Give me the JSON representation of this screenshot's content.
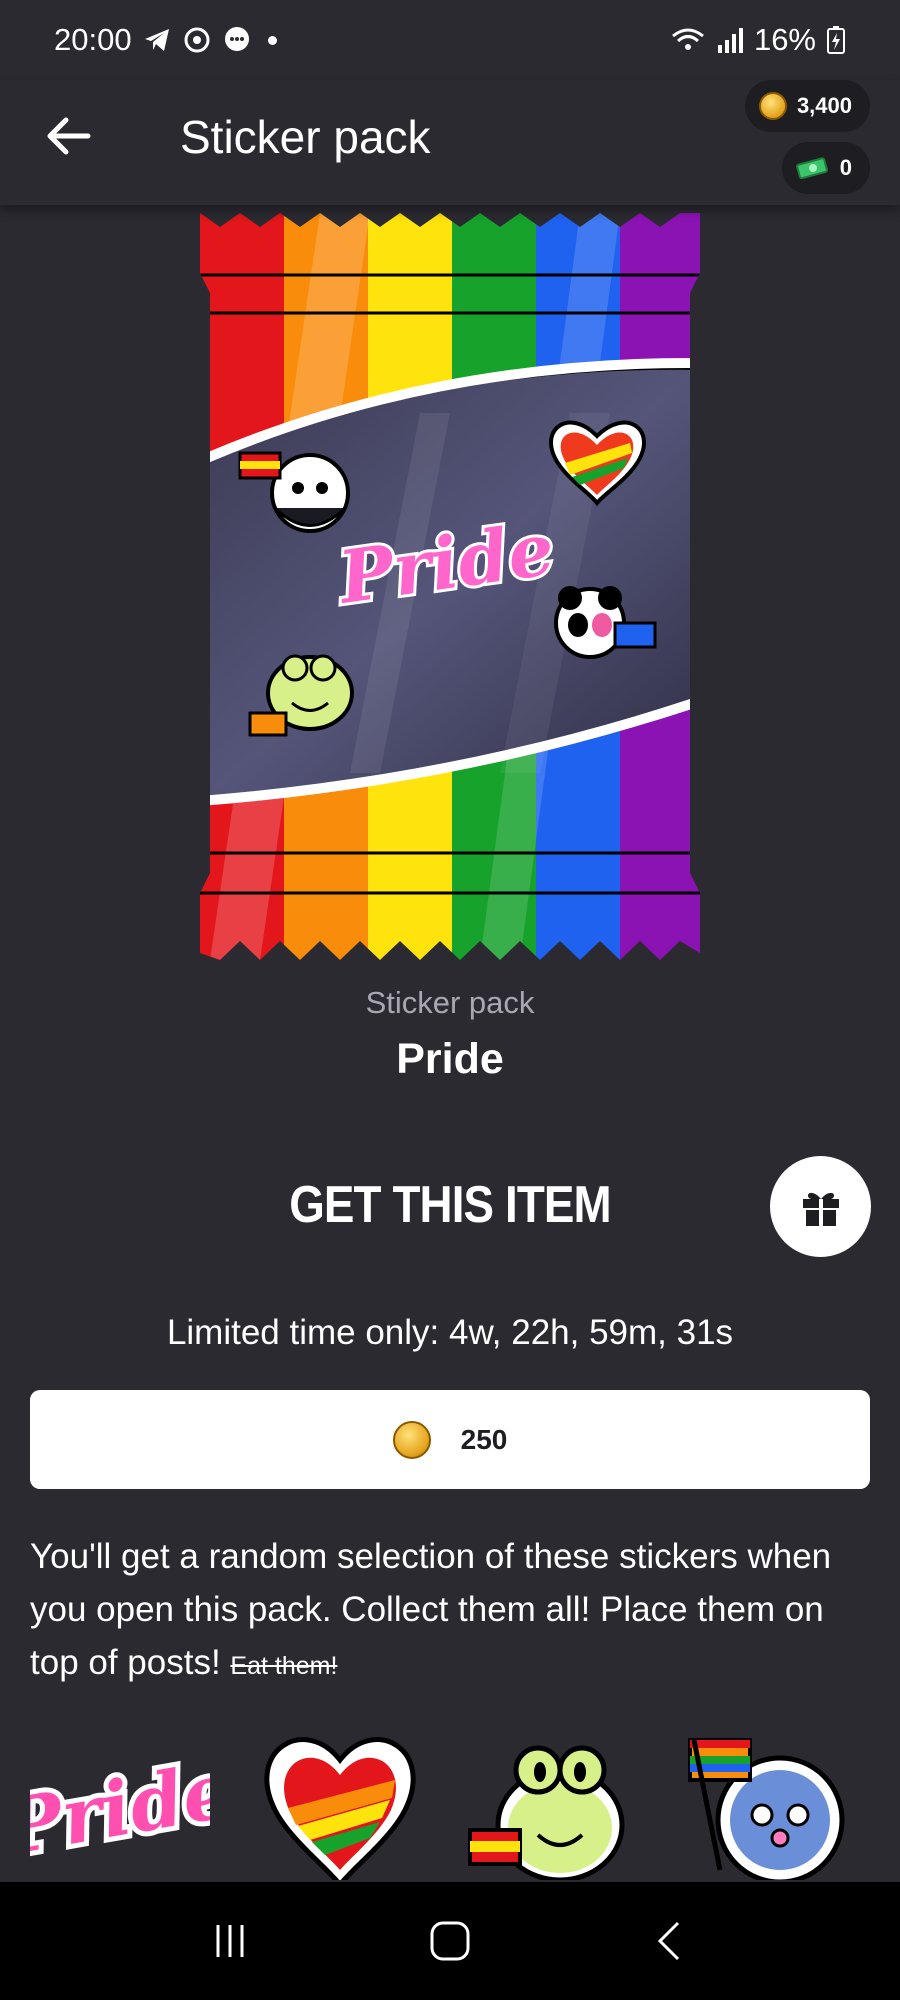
{
  "status_bar": {
    "time": "20:00",
    "battery": "16%"
  },
  "header": {
    "title": "Sticker pack",
    "coins": "3,400",
    "bucks": "0"
  },
  "pack_art": {
    "word": "Pride"
  },
  "item": {
    "type_label": "Sticker pack",
    "name": "Pride"
  },
  "purchase": {
    "heading": "GET THIS ITEM",
    "timer": "Limited time only: 4w, 22h, 59m, 31s",
    "price": "250"
  },
  "description": {
    "text": "You'll get a random selection of these stickers when you open this pack. Collect them all! Place them on top of posts! ",
    "struck": "Eat them!"
  },
  "stickers": [
    {
      "name": "pride-word-sticker",
      "label": "Pride"
    },
    {
      "name": "rainbow-heart-sticker"
    },
    {
      "name": "frog-flag-sticker"
    },
    {
      "name": "ghost-flag-sticker"
    }
  ],
  "colors": {
    "background": "#2b2a31",
    "rainbow": [
      "#e3161b",
      "#f98c0a",
      "#ffe30d",
      "#17a22c",
      "#1f62f0",
      "#8b13b3"
    ]
  }
}
